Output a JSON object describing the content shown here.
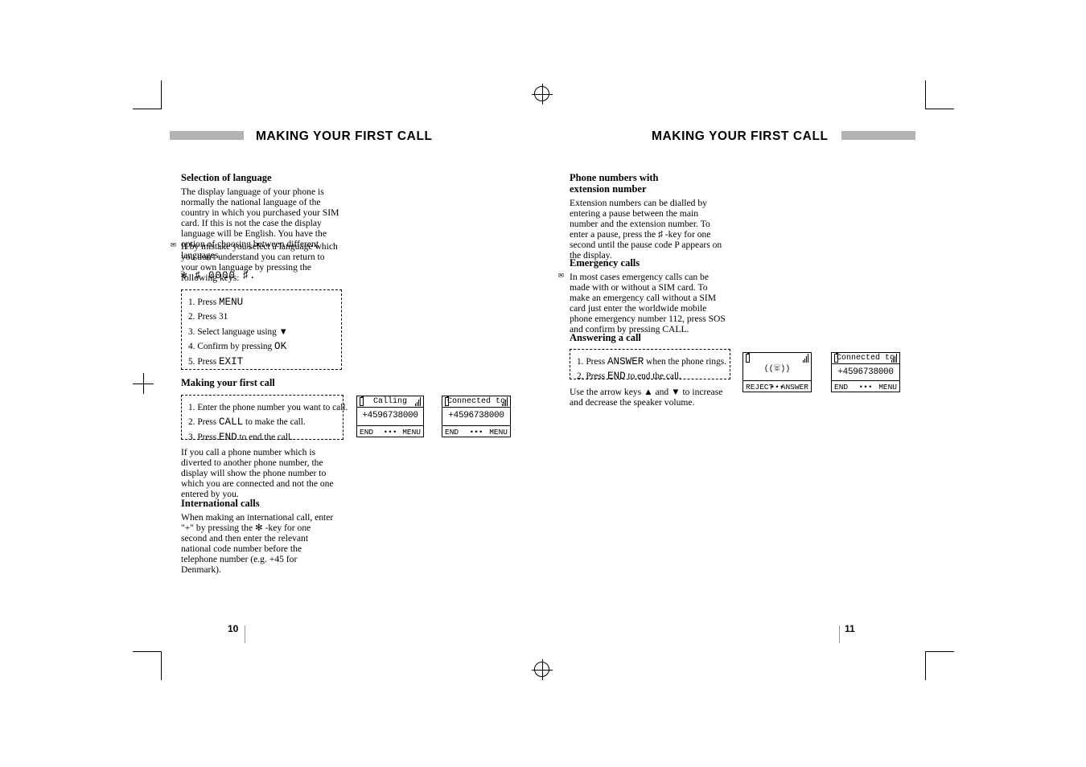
{
  "document": {
    "left_page": {
      "header": "MAKING YOUR FIRST CALL",
      "page_number": "10",
      "sections": [
        {
          "heading": "Selection of language",
          "paragraphs": [
            "The display language of your phone is normally the national language of the country in which you purchased your SIM card. If this is not the case the display language will be English. You have the option of choosing between different languages.",
            "If by mistake you select a language which you don't understand you can return to your own language by pressing the following keys:"
          ],
          "key_sequence": "✻  ♯ 0000 ♯.",
          "steps": [
            {
              "num": "1.",
              "text": "Press ",
              "mono": "MENU",
              "after": ""
            },
            {
              "num": "2.",
              "text": "Press 31",
              "mono": "",
              "after": ""
            },
            {
              "num": "3.",
              "text": "Select language using ",
              "mono": "",
              "after": "▼"
            },
            {
              "num": "4.",
              "text": "Confirm by pressing ",
              "mono": "OK",
              "after": ""
            },
            {
              "num": "5.",
              "text": "Press ",
              "mono": "EXIT",
              "after": ""
            }
          ]
        },
        {
          "heading": "Making your first call",
          "steps": [
            {
              "num": "1.",
              "text": "Enter the phone number you want to call.",
              "mono": "",
              "after": ""
            },
            {
              "num": "2.",
              "text": "Press ",
              "mono": "CALL",
              "after": " to make the call."
            },
            {
              "num": "3.",
              "text": "Press ",
              "mono": "END",
              "after": " to end the call."
            }
          ],
          "paragraphs": [
            "If you call a phone number which is diverted to another phone number, the display will show the phone number to which you are connected and not the one entered by you."
          ]
        },
        {
          "heading": "International calls",
          "paragraphs": [
            "When making an international call, enter \"+\" by pressing the ✻ -key for one second and then enter the relevant national code number before the telephone number (e.g. +45 for Denmark)."
          ]
        }
      ],
      "displays": [
        {
          "title": "Calling",
          "number": "+4596738000",
          "left": "END",
          "center": "•••",
          "right": "MENU"
        },
        {
          "title": "Connected to",
          "number": "+4596738000",
          "left": "END",
          "center": "•••",
          "right": "MENU"
        }
      ]
    },
    "right_page": {
      "header": "MAKING YOUR FIRST CALL",
      "page_number": "11",
      "sections": [
        {
          "heading": "Phone numbers with\nextension number",
          "paragraphs": [
            "Extension numbers can be dialled by entering a pause between the main number and the extension number. To enter a pause, press the ♯ -key for one second until the pause code P appears on the display."
          ]
        },
        {
          "heading": "Emergency calls",
          "paragraphs": [
            "In most cases emergency calls can be made with or without a SIM card. To make an emergency call without a SIM card just enter the worldwide mobile phone emergency number 112, press SOS and confirm by pressing CALL."
          ]
        },
        {
          "heading": "Answering a call",
          "steps": [
            {
              "num": "1.",
              "text": "Press ",
              "mono": "ANSWER",
              "after": " when the phone rings."
            },
            {
              "num": "2.",
              "text": "Press ",
              "mono": "END",
              "after": " to end the call."
            }
          ],
          "paragraphs": [
            "Use the arrow keys ▲ and ▼ to increase and decrease the speaker volume."
          ]
        }
      ],
      "displays": [
        {
          "title": "",
          "number": "",
          "left": "REJECT",
          "center": "•••",
          "right": "ANSWER"
        },
        {
          "title": "Connected to",
          "number": "+4596738000",
          "left": "END",
          "center": "•••",
          "right": "MENU"
        }
      ]
    }
  },
  "colors": {
    "header_bar": "#b3b3b3",
    "text": "#000000",
    "background": "#ffffff"
  }
}
